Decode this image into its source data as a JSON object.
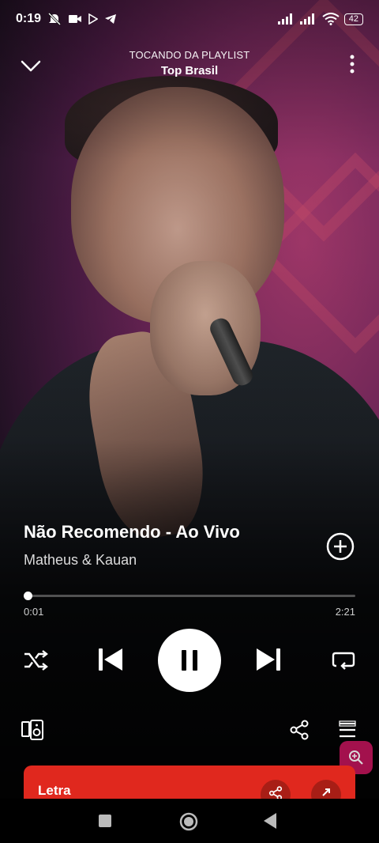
{
  "status_bar": {
    "time": "0:19",
    "battery": "42"
  },
  "header": {
    "context_label": "TOCANDO DA PLAYLIST",
    "playlist_name": "Top Brasil"
  },
  "track": {
    "title": "Não Recomendo - Ao Vivo",
    "artist": "Matheus & Kauan"
  },
  "progress": {
    "current_time": "0:01",
    "total_time": "2:21",
    "fraction": 0.007
  },
  "lyrics": {
    "label": "Letra"
  },
  "colors": {
    "lyrics_card": "#e0281e",
    "zoom_button": "#c0145a",
    "background": "#000000"
  },
  "icons": [
    "chevron-down-icon",
    "more-vert-icon",
    "add-circle-icon",
    "shuffle-icon",
    "skip-previous-icon",
    "pause-icon",
    "skip-next-icon",
    "repeat-icon",
    "devices-icon",
    "share-icon",
    "queue-icon",
    "zoom-icon"
  ]
}
